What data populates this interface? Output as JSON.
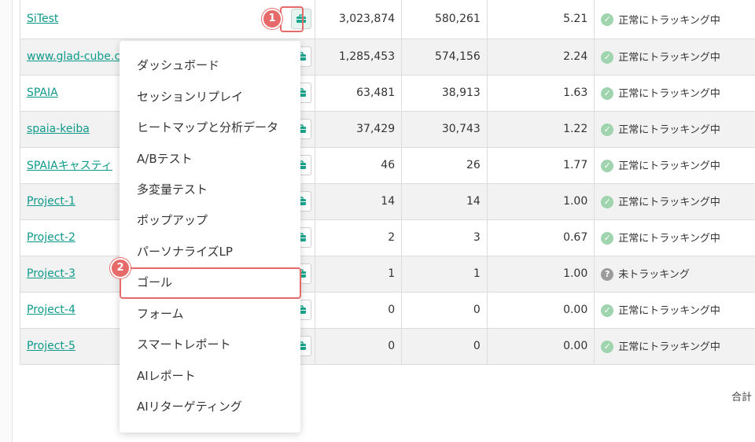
{
  "sites": [
    {
      "name": "SiTest",
      "v1": "3,023,874",
      "v2": "580,261",
      "rate": "5.21",
      "status": "正常にトラッキング中",
      "status_type": "ok"
    },
    {
      "name": "www.glad-cube.c",
      "v1": "1,285,453",
      "v2": "574,156",
      "rate": "2.24",
      "status": "正常にトラッキング中",
      "status_type": "ok"
    },
    {
      "name": "SPAIA",
      "v1": "63,481",
      "v2": "38,913",
      "rate": "1.63",
      "status": "正常にトラッキング中",
      "status_type": "ok"
    },
    {
      "name": "spaia-keiba",
      "v1": "37,429",
      "v2": "30,743",
      "rate": "1.22",
      "status": "正常にトラッキング中",
      "status_type": "ok"
    },
    {
      "name": "SPAIAキャスティ",
      "v1": "46",
      "v2": "26",
      "rate": "1.77",
      "status": "正常にトラッキング中",
      "status_type": "ok"
    },
    {
      "name": "Project-1",
      "v1": "14",
      "v2": "14",
      "rate": "1.00",
      "status": "正常にトラッキング中",
      "status_type": "ok"
    },
    {
      "name": "Project-2",
      "v1": "2",
      "v2": "3",
      "rate": "0.67",
      "status": "正常にトラッキング中",
      "status_type": "ok"
    },
    {
      "name": "Project-3",
      "v1": "1",
      "v2": "1",
      "rate": "1.00",
      "status": "未トラッキング",
      "status_type": "unknown"
    },
    {
      "name": "Project-4",
      "v1": "0",
      "v2": "0",
      "rate": "0.00",
      "status": "正常にトラッキング中",
      "status_type": "ok"
    },
    {
      "name": "Project-5",
      "v1": "0",
      "v2": "0",
      "rate": "0.00",
      "status": "正常にトラッキング中",
      "status_type": "ok"
    }
  ],
  "menu": {
    "items": [
      "ダッシュボード",
      "セッションリプレイ",
      "ヒートマップと分析データ",
      "A/Bテスト",
      "多変量テスト",
      "ポップアップ",
      "パーソナライズLP",
      "ゴール",
      "フォーム",
      "スマートレポート",
      "AIレポート",
      "AIリターゲティング"
    ]
  },
  "footer": {
    "total_label": "合計"
  },
  "markers": {
    "step1": "1",
    "step2": "2"
  },
  "colors": {
    "link": "#0e9a8a",
    "accent": "#1aa88f",
    "highlight": "#e76a6a",
    "status_ok": "#9fd4ae",
    "status_unknown": "#9b9b9b"
  },
  "icons": {
    "tool": "briefcase-icon",
    "ok": "check-circle-icon",
    "unknown": "question-circle-icon"
  }
}
